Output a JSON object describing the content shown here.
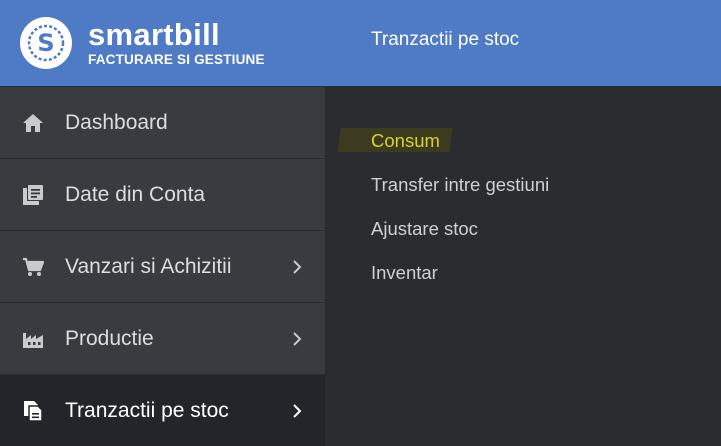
{
  "brand": {
    "name": "smartbill",
    "tagline": "FACTURARE SI GESTIUNE"
  },
  "sidebar": {
    "items": [
      {
        "label": "Dashboard",
        "icon": "home-icon",
        "has_chevron": false,
        "active": false
      },
      {
        "label": "Date din Conta",
        "icon": "documents-icon",
        "has_chevron": false,
        "active": false
      },
      {
        "label": "Vanzari si Achizitii",
        "icon": "cart-icon",
        "has_chevron": true,
        "active": false
      },
      {
        "label": "Productie",
        "icon": "factory-icon",
        "has_chevron": true,
        "active": false
      },
      {
        "label": "Tranzactii pe stoc",
        "icon": "stock-transactions-icon",
        "has_chevron": true,
        "active": true
      }
    ]
  },
  "panel": {
    "title": "Tranzactii pe stoc",
    "links": [
      {
        "label": "Consum",
        "highlighted": true
      },
      {
        "label": "Transfer intre gestiuni",
        "highlighted": false
      },
      {
        "label": "Ajustare stoc",
        "highlighted": false
      },
      {
        "label": "Inventar",
        "highlighted": false
      }
    ]
  },
  "colors": {
    "header_blue": "#4f7ac6",
    "sidebar_bg": "#3a3b40",
    "active_bg": "#24252a",
    "panel_bg": "#2b2c30",
    "highlight_text": "#d8d52a"
  }
}
